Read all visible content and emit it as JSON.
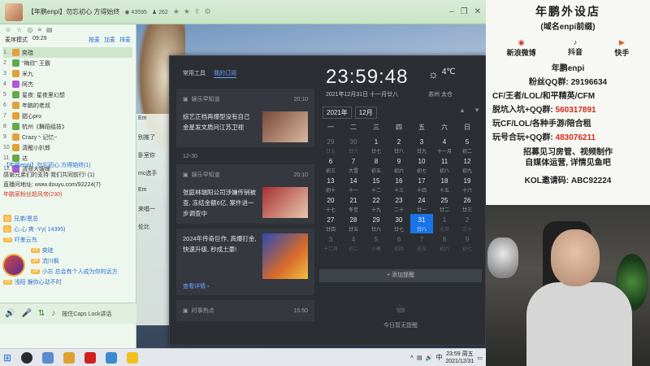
{
  "topbar": {
    "title": "【年鹏enpi】勿忘初心 方得始终",
    "viewers": "43595",
    "fans": "262",
    "win_controls": [
      "‒",
      "❐",
      "✕"
    ]
  },
  "left": {
    "tools": [
      "☺",
      "☆",
      "◎",
      "≡",
      "▤"
    ],
    "mode_label": "麦序模式",
    "mode_time": "09:29",
    "mode_links": [
      "按麦",
      "加麦",
      "排麦"
    ],
    "users": [
      {
        "num": "1",
        "name": "奕琏"
      },
      {
        "num": "2",
        "name": "\"梅欣\" 王霸"
      },
      {
        "num": "3",
        "name": "米九"
      },
      {
        "num": "4",
        "name": "阿杰"
      },
      {
        "num": "5",
        "name": "星夜: 星夜里幻想"
      },
      {
        "num": "6",
        "name": "年鹏的老叔"
      },
      {
        "num": "7",
        "name": "甜心pro"
      },
      {
        "num": "8",
        "name": "杭州《舞蹈组技》"
      },
      {
        "num": "9",
        "name": "Crazy丶记忆~"
      },
      {
        "num": "10",
        "name": "清醒小扒郎"
      },
      {
        "num": "11",
        "name": "达"
      },
      {
        "num": "12",
        "name": "清哥大嫂婶"
      }
    ],
    "chat_lines": [
      "【年鹏enpi】勿忘初心 方得始终(1)",
      "感谢兄弟们的支持 我们共同前行! (1)",
      "直播间地址: www.douyu.com/92224(7)",
      "年鹏家粉丝超风帝(230)"
    ],
    "messages": [
      {
        "badge": "分",
        "name": "兄弟/恩总"
      },
      {
        "badge": "心",
        "name": "心.心 爽 -Yy( 14395)"
      },
      {
        "badge": "25",
        "name": "吓差云鸟"
      },
      {
        "badge": "24",
        "name": "奕琏"
      },
      {
        "badge": "24",
        "name": "流川枫"
      },
      {
        "badge": "24",
        "name": "小忘 总会有个人成为你的远方"
      },
      {
        "badge": "25",
        "name": "浅阳 猴你心动不时"
      }
    ],
    "bottom_hint": "按住Caps Lock讲话"
  },
  "stream": {
    "side_items": [
      "Em",
      "别推了",
      "卧室你",
      "mc选手",
      "Em",
      "来唱一",
      "伦比"
    ]
  },
  "notif": {
    "tabs": [
      "常用工具",
      "我的订阅"
    ],
    "cards": [
      {
        "source": "娱乐早知道",
        "time": "20:10",
        "text": "综艺正档再爆型没有自己 金星发文质问江苏卫视"
      },
      {
        "source": "娱乐早知道",
        "time": "20:10",
        "text": "张庭林瑞阳公司涉嫌传销被查, 冻结金额6亿, 案件进一步调查中"
      },
      {
        "text": "2024年传奇巨作, 高爆打金, 快速升级, 秒成土豪!",
        "more": "查看详情 ›"
      },
      {
        "source": "时事热点",
        "time": "15:50"
      }
    ],
    "date_gap": "12-30",
    "clock": "23:59:48",
    "full_date": "2021年12月31日 十一月廿八",
    "weather": {
      "temp": "4℃",
      "location": "苏州 太仓"
    },
    "year_select": "2021年",
    "month_select": "12月",
    "nav_arrows": "▲ ▼",
    "weekdays": [
      "一",
      "二",
      "三",
      "四",
      "五",
      "六",
      "日"
    ],
    "days": [
      {
        "d": "29",
        "l": "廿五",
        "dim": true
      },
      {
        "d": "30",
        "l": "廿六",
        "dim": true
      },
      {
        "d": "1",
        "l": "廿七"
      },
      {
        "d": "2",
        "l": "廿八"
      },
      {
        "d": "3",
        "l": "廿九"
      },
      {
        "d": "4",
        "l": "十一月"
      },
      {
        "d": "5",
        "l": "初二"
      },
      {
        "d": "6",
        "l": "初三"
      },
      {
        "d": "7",
        "l": "大雪"
      },
      {
        "d": "8",
        "l": "初五"
      },
      {
        "d": "9",
        "l": "初六"
      },
      {
        "d": "10",
        "l": "初七"
      },
      {
        "d": "11",
        "l": "初八"
      },
      {
        "d": "12",
        "l": "初九"
      },
      {
        "d": "13",
        "l": "初十"
      },
      {
        "d": "14",
        "l": "十一"
      },
      {
        "d": "15",
        "l": "十二"
      },
      {
        "d": "16",
        "l": "十三"
      },
      {
        "d": "17",
        "l": "十四"
      },
      {
        "d": "18",
        "l": "十五"
      },
      {
        "d": "19",
        "l": "十六"
      },
      {
        "d": "20",
        "l": "十七"
      },
      {
        "d": "21",
        "l": "冬至"
      },
      {
        "d": "22",
        "l": "十九"
      },
      {
        "d": "23",
        "l": "二十"
      },
      {
        "d": "24",
        "l": "廿一"
      },
      {
        "d": "25",
        "l": "廿二"
      },
      {
        "d": "26",
        "l": "廿三"
      },
      {
        "d": "27",
        "l": "廿四"
      },
      {
        "d": "28",
        "l": "廿五"
      },
      {
        "d": "29",
        "l": "廿六"
      },
      {
        "d": "30",
        "l": "廿七"
      },
      {
        "d": "31",
        "l": "廿八",
        "today": true
      },
      {
        "d": "1",
        "l": "元旦",
        "dim": true
      },
      {
        "d": "2",
        "l": "三十",
        "dim": true
      },
      {
        "d": "3",
        "l": "十二月",
        "dim": true
      },
      {
        "d": "4",
        "l": "初二",
        "dim": true
      },
      {
        "d": "5",
        "l": "小寒",
        "dim": true
      },
      {
        "d": "6",
        "l": "初四",
        "dim": true
      },
      {
        "d": "7",
        "l": "初五",
        "dim": true
      },
      {
        "d": "8",
        "l": "初六",
        "dim": true
      },
      {
        "d": "9",
        "l": "初七",
        "dim": true
      }
    ],
    "add_reminder": "+ 添加提醒",
    "no_reminder": "今日暂无提醒"
  },
  "promo": {
    "shop": "年鹏外设店",
    "domain": "(域名enpi前缀)",
    "socials": [
      {
        "icon": "weibo-icon",
        "label": "新浪微博"
      },
      {
        "icon": "douyin-icon",
        "label": "抖音"
      },
      {
        "icon": "kuaishou-icon",
        "label": "快手"
      }
    ],
    "author": "年鹏enpi",
    "fans_group": "粉丝QQ群: 29196634",
    "lines": [
      {
        "text": "CF/王者/LOL/和平精英/CFM",
        "red": ""
      },
      {
        "text": "脱坑入坑+QQ群: ",
        "red": "560317891"
      },
      {
        "text": "玩CF/LOL/各种手游/陪合租",
        "red": ""
      },
      {
        "text": "玩号合玩+QQ群: ",
        "red": "483076211"
      }
    ],
    "biz": [
      "招募见习房管、视频制作",
      "自媒体运营, 详情见鱼吧"
    ],
    "kol": "KOL邀请码: ABC92224"
  },
  "taskbar": {
    "start": "⊞",
    "time": "23:59 周五",
    "date": "2021/12/31",
    "lang": "中"
  },
  "colors": {
    "accent": "#1a73e8",
    "promo_red": "#d82a1a",
    "panel_bg": "#2b2e33"
  }
}
